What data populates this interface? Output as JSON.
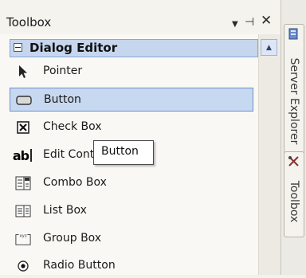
{
  "panel": {
    "title": "Toolbox",
    "controls": {
      "menu": "▼",
      "pin": "⊣",
      "close": "✕"
    }
  },
  "group": {
    "label": "Dialog Editor",
    "expanded": true
  },
  "items": [
    {
      "label": "Pointer",
      "icon": "pointer-icon"
    },
    {
      "label": "Button",
      "icon": "button-icon",
      "selected": true
    },
    {
      "label": "Check Box",
      "icon": "check-box-icon"
    },
    {
      "label": "Edit Control",
      "icon": "edit-control-icon"
    },
    {
      "label": "Combo Box",
      "icon": "combo-box-icon"
    },
    {
      "label": "List Box",
      "icon": "list-box-icon"
    },
    {
      "label": "Group Box",
      "icon": "group-box-icon"
    },
    {
      "label": "Radio Button",
      "icon": "radio-button-icon"
    }
  ],
  "tooltip": {
    "text": "Button"
  },
  "side_tabs": [
    {
      "label": "Server Explorer",
      "icon": "server-explorer-icon"
    },
    {
      "label": "Toolbox",
      "icon": "toolbox-icon"
    }
  ],
  "colors": {
    "selection": "#c7d9f1",
    "selection_border": "#6f8fc7",
    "header": "#c6d6ee"
  }
}
